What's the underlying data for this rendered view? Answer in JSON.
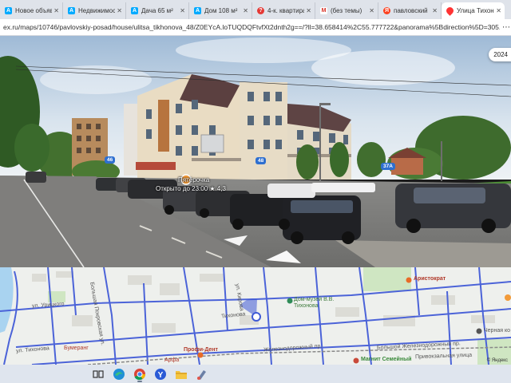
{
  "tabs": [
    {
      "label": "Новое объявл",
      "icon": "avito-icon",
      "color": "#00aaff",
      "active": false
    },
    {
      "label": "Недвижимость",
      "icon": "avito-icon",
      "color": "#00aaff",
      "active": false
    },
    {
      "label": "Дача 65 м²",
      "icon": "avito-icon",
      "color": "#00aaff",
      "active": false
    },
    {
      "label": "Дом 108 м²",
      "icon": "avito-icon",
      "color": "#00aaff",
      "active": false
    },
    {
      "label": "4-к. квартира",
      "icon": "cian-icon",
      "color": "#e53935",
      "active": false
    },
    {
      "label": "(без темы)",
      "icon": "gmail-icon",
      "color": "#d93025",
      "active": false
    },
    {
      "label": "павловский",
      "icon": "yandex-icon",
      "color": "#fc3f1d",
      "active": false
    },
    {
      "label": "Улица Тихоно",
      "icon": "yandex-maps-icon",
      "color": "#ff3333",
      "active": true
    }
  ],
  "address_bar": {
    "url": "ex.ru/maps/10746/pavlovskiy-posad/house/ulitsa_tikhonova_48/Z0EYcA.loTUQDQFtvfXt2dnth2g==/?ll=38.658414%2C55.777722&panorama%5Bdirection%5D=305.048616%2C..."
  },
  "panorama": {
    "year": "2024",
    "shop_name": "Пятёрочка",
    "shop_hours": "Открыто до 23:00 ★ 4,3",
    "house_numbers": [
      "46",
      "48",
      "37А"
    ]
  },
  "map": {
    "streets": [
      "Большая Покровская ул.",
      "ул. Тихонова",
      "Железнодорожный пр.",
      "Привокзальная улица",
      "Большой Железнодорожный пр.",
      "ул. Кирова",
      "ул. Урицкого",
      "Тихонова"
    ],
    "pois": [
      "Аристократ",
      "Дом-музей В.В. Тихонова",
      "Профи-Дент",
      "Бумеранг",
      "Магнит Семейный",
      "Арфа",
      "Черная ко"
    ],
    "provider": "© Яндекс"
  },
  "colors": {
    "road": "#4b63d8",
    "map_bg": "#eef0ed",
    "sky": "#b9cfe4",
    "brand_yandex": "#fc3f1d"
  }
}
